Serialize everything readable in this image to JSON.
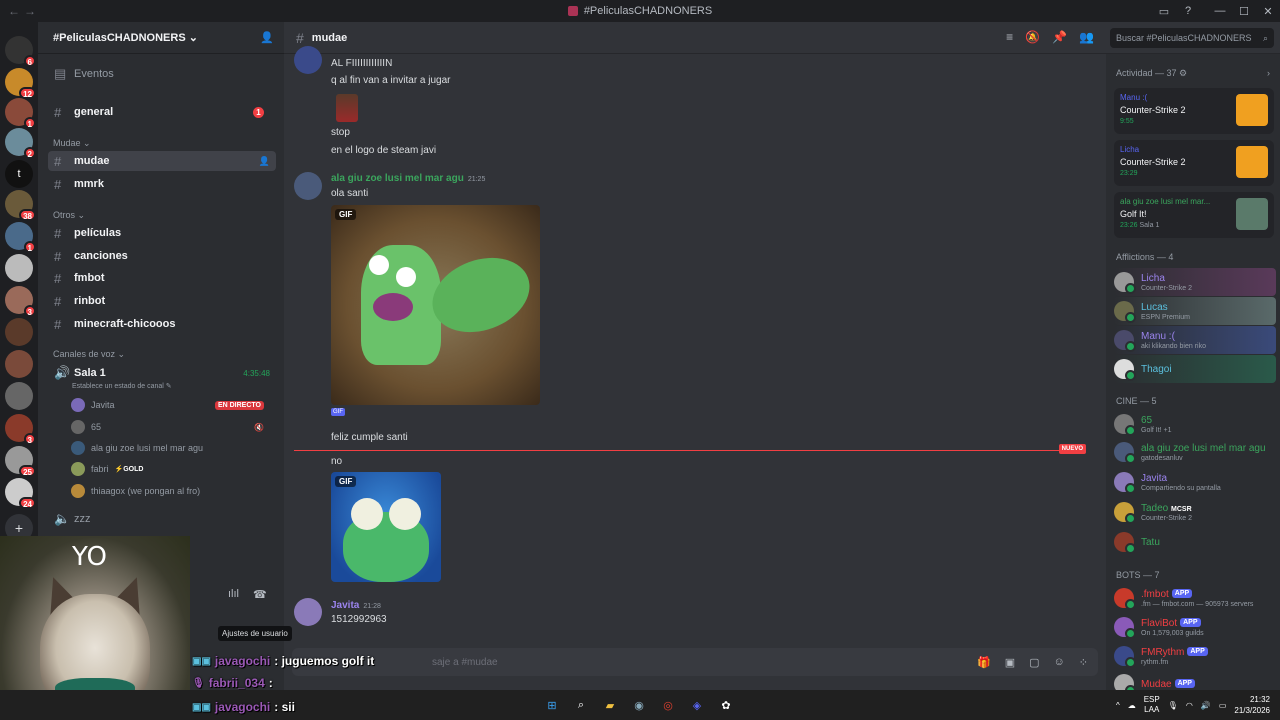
{
  "window": {
    "title": "#PeliculasCHADNONERS"
  },
  "guild": {
    "name": "#PeliculasCHADNONERS",
    "events_label": "Eventos"
  },
  "channels": {
    "general": "general",
    "general_badge": "1",
    "cat_mudae": "Mudae",
    "mudae": "mudae",
    "mmrk": "mmrk",
    "cat_otros": "Otros",
    "peliculas": "películas",
    "canciones": "canciones",
    "fmbot": "fmbot",
    "rinbot": "rinbot",
    "minecraft": "minecraft-chicooos",
    "cat_voz": "Canales de voz",
    "sala1": "Sala 1",
    "sala1_time": "4:35:48",
    "sala1_status": "Establece un estado de canal",
    "live_label": "EN DIRECTO",
    "voice_users": [
      "Javita",
      "65",
      "ala giu zoe lusi mel mar agu",
      "fabri",
      "thiaagox (we pongan al fro)"
    ],
    "gold_label": "⚡GOLD",
    "zzz": "zzz"
  },
  "server_badges": [
    "6",
    "12",
    "1",
    "",
    "2",
    "",
    "38",
    "1",
    "",
    "3",
    "",
    "",
    "",
    "3",
    "25",
    "24"
  ],
  "chat": {
    "channel_name": "mudae",
    "messages": {
      "m1": "AL FIIIIIIIIIIIIN",
      "m2": "q al fin van a invitar a jugar",
      "m3": "stop",
      "m4": "en el logo de steam javi",
      "author2": "ala giu zoe lusi mel mar agu",
      "time2": "21:25",
      "m5": "ola santi",
      "gif_label": "GIF",
      "m6": "feliz cumple santi",
      "m7": "no",
      "author3": "Javita",
      "time3": "21:28",
      "m8": "1512992963"
    },
    "new_label": "NUEVO",
    "composer_placeholder": "saje a #mudae"
  },
  "search": {
    "placeholder": "Buscar #PeliculasCHADNONERS"
  },
  "members": {
    "activity_header": "Actividad — 37",
    "activities": [
      {
        "who": "Manu :(",
        "game": "Counter-Strike 2",
        "time": "9:55"
      },
      {
        "who": "Licha",
        "game": "Counter-Strike 2",
        "time": "23:29"
      },
      {
        "who": "ala giu zoe lusi mel mar...",
        "game": "Golf It!",
        "time": "23:26",
        "extra": "Sala 1"
      }
    ],
    "afflictions_header": "Afflictions — 4",
    "afflictions": [
      {
        "name": "Licha",
        "sub": "Counter-Strike 2"
      },
      {
        "name": "Lucas",
        "sub": "ESPN Premium"
      },
      {
        "name": "Manu :(",
        "sub": "aki klikando bien riko"
      },
      {
        "name": "Thagoi",
        "sub": ""
      }
    ],
    "cine_header": "CINE — 5",
    "cine": [
      {
        "name": "65",
        "sub": "Golf It! +1"
      },
      {
        "name": "ala giu zoe lusi mel mar agu",
        "sub": "gatodesanluv"
      },
      {
        "name": "Javita",
        "sub": "Compartiendo su pantalla"
      },
      {
        "name": "Tadeo",
        "sub": "Counter-Strike 2",
        "tag": "MCSR"
      },
      {
        "name": "Tatu",
        "sub": ""
      }
    ],
    "bots_header": "BOTS — 7",
    "bots": [
      {
        "name": ".fmbot",
        "sub": ".fm — fmbot.com — 905973 servers"
      },
      {
        "name": "FlaviBot",
        "sub": "On 1,579,003 guilds"
      },
      {
        "name": "FMRythm",
        "sub": "rythm.fm"
      },
      {
        "name": "Mudae",
        "sub": ""
      }
    ],
    "app_tag": "APP"
  },
  "overlay": {
    "cam_text": "YO",
    "chat_lines": [
      {
        "user": "javagochi",
        "text": ": juguemos golf it"
      },
      {
        "user": "fabrii_034",
        "text": ":"
      },
      {
        "user": "javagochi",
        "text": ": sii"
      }
    ],
    "tooltip": "Ajustes de usuario"
  },
  "taskbar": {
    "lang1": "ESP",
    "lang2": "LAA",
    "time": "21:32",
    "date": "21/3/2026"
  },
  "colors": {
    "accent": "#5865f2",
    "green": "#23a55a",
    "red": "#f23f43"
  }
}
